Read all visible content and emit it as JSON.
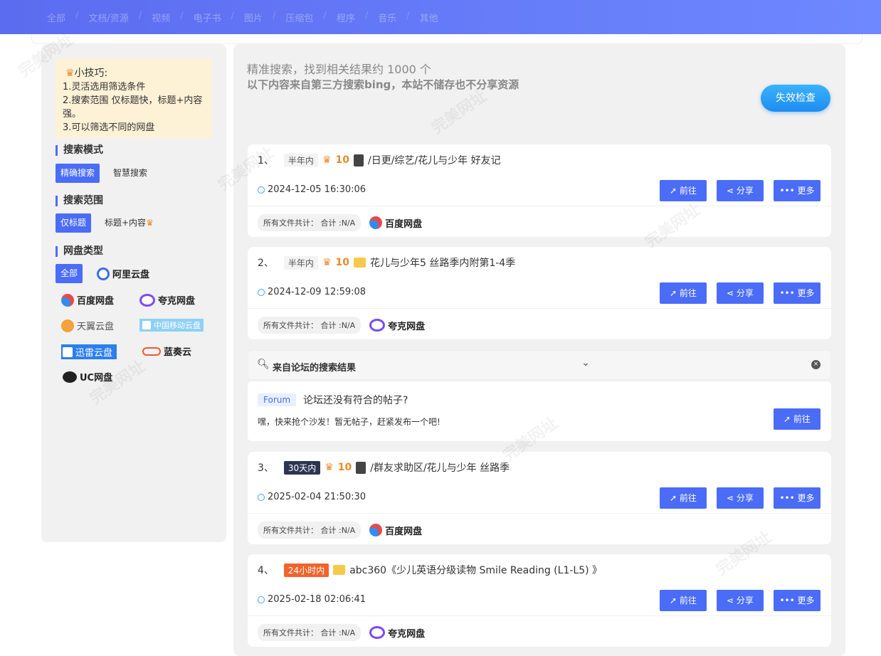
{
  "topnav": [
    "全部",
    "文档/资源",
    "视频",
    "电子书",
    "图片",
    "压缩包",
    "程序",
    "音乐",
    "其他"
  ],
  "sidebar": {
    "tip": {
      "title": "小技巧:",
      "lines": [
        "1.灵活选用筛选条件",
        "2.搜索范围 仅标题快，标题+内容强。",
        "3.可以筛选不同的网盘"
      ]
    },
    "mode": {
      "title": "搜索模式",
      "active": "精确搜索",
      "other": "智慧搜索"
    },
    "scope": {
      "title": "搜索范围",
      "active": "仅标题",
      "other": "标题+内容"
    },
    "disk": {
      "title": "网盘类型",
      "active": "全部",
      "items": [
        "阿里云盘",
        "百度网盘",
        "夸克网盘",
        "天翼云盘",
        "中国移动云盘",
        "迅雷云盘",
        "蓝奏云",
        "UC网盘"
      ]
    }
  },
  "main": {
    "summary": "精准搜索，找到相关结果约 1000 个",
    "disclaimer": "以下内容来自第三方搜索bing，本站不储存也不分享资源",
    "check_btn": "失效检查",
    "actions": {
      "go": "前往",
      "share": "分享",
      "more": "更多"
    },
    "file_summary": "所有文件共计：  合计 :N/A",
    "results": [
      {
        "index": "1、",
        "badge": "半年内",
        "score": "10",
        "title": "/日更/综艺/花儿与少年 好友记",
        "date": "2024-12-05 16:30:06",
        "disk": "百度网盘"
      },
      {
        "index": "2、",
        "badge": "半年内",
        "score": "10",
        "title": "花儿与少年5 丝路季内附第1-4季",
        "date": "2024-12-09 12:59:08",
        "disk": "夸克网盘"
      },
      {
        "index": "3、",
        "badge": "30天内",
        "score": "10",
        "title": "/群友求助区/花儿与少年 丝路季",
        "date": "2025-02-04 21:50:30",
        "disk": "百度网盘"
      },
      {
        "index": "4、",
        "badge": "24小时内",
        "score": "",
        "title": "abc360《少儿英语分级读物 Smile Reading (L1-L5) 》",
        "date": "2025-02-18 02:06:41",
        "disk": "夸克网盘"
      }
    ],
    "forum": {
      "header": "来自论坛的搜索结果",
      "tag": "Forum",
      "question": "论坛还没有符合的帖子?",
      "message": "嘿，快来抢个沙发！暂无帖子，赶紧发布一个吧!",
      "go": "前往"
    }
  },
  "watermark": "完美网址"
}
